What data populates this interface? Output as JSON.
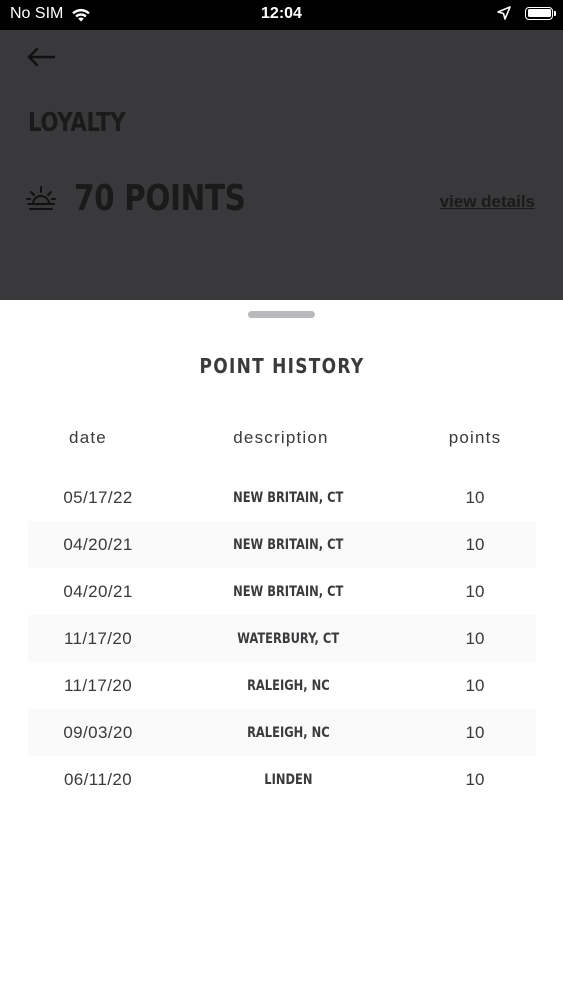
{
  "status_bar": {
    "carrier": "No SIM",
    "time": "12:04"
  },
  "header": {
    "title": "LOYALTY",
    "points_label": "70 POINTS",
    "view_details_label": "view details"
  },
  "sheet": {
    "title": "POINT HISTORY",
    "columns": {
      "date": "date",
      "description": "description",
      "points": "points"
    },
    "rows": [
      {
        "date": "05/17/22",
        "description": "NEW BRITAIN, CT",
        "points": "10"
      },
      {
        "date": "04/20/21",
        "description": "NEW BRITAIN, CT",
        "points": "10"
      },
      {
        "date": "04/20/21",
        "description": "NEW BRITAIN, CT",
        "points": "10"
      },
      {
        "date": "11/17/20",
        "description": "WATERBURY, CT",
        "points": "10"
      },
      {
        "date": "11/17/20",
        "description": "RALEIGH, NC",
        "points": "10"
      },
      {
        "date": "09/03/20",
        "description": "RALEIGH, NC",
        "points": "10"
      },
      {
        "date": "06/11/20",
        "description": "LINDEN",
        "points": "10"
      }
    ]
  },
  "icons": {
    "back": "arrow-left-icon",
    "points": "sun-rise-icon",
    "wifi": "wifi-icon",
    "location": "location-arrow-icon",
    "battery": "battery-icon"
  },
  "colors": {
    "backdrop": "#39393b",
    "sheet": "#ffffff",
    "text": "#3a3a3c",
    "handle": "#b9b9bb",
    "stripe": "#fafafb"
  }
}
